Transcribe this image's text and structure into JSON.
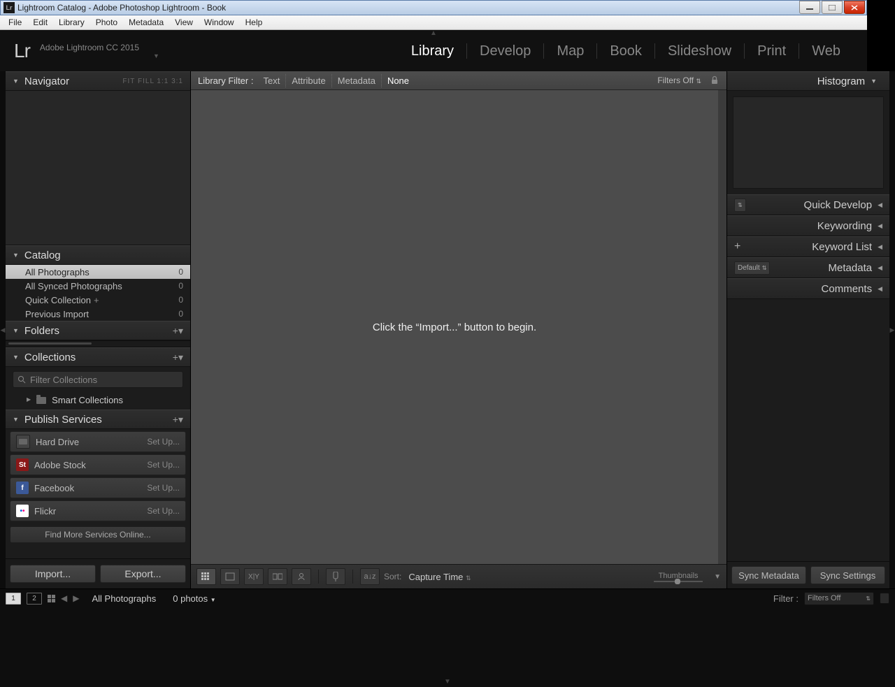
{
  "window": {
    "title": "Lightroom Catalog - Adobe Photoshop Lightroom - Book",
    "app_badge": "Lr"
  },
  "menu": [
    "File",
    "Edit",
    "Library",
    "Photo",
    "Metadata",
    "View",
    "Window",
    "Help"
  ],
  "identity": {
    "logo": "Lr",
    "subtitle": "Adobe Lightroom CC 2015"
  },
  "modules": {
    "items": [
      "Library",
      "Develop",
      "Map",
      "Book",
      "Slideshow",
      "Print",
      "Web"
    ],
    "active": "Library"
  },
  "left": {
    "navigator": {
      "title": "Navigator",
      "opts": "FIT   FILL   1:1   3:1"
    },
    "catalog": {
      "title": "Catalog",
      "rows": [
        {
          "label": "All Photographs",
          "count": "0",
          "selected": true
        },
        {
          "label": "All Synced Photographs",
          "count": "0"
        },
        {
          "label": "Quick Collection",
          "count": "0",
          "plus": true
        },
        {
          "label": "Previous Import",
          "count": "0"
        }
      ]
    },
    "folders": {
      "title": "Folders"
    },
    "collections": {
      "title": "Collections",
      "filter_placeholder": "Filter Collections",
      "smart": "Smart Collections"
    },
    "publish": {
      "title": "Publish Services",
      "rows": [
        {
          "label": "Hard Drive",
          "setup": "Set Up...",
          "icon": "hdd"
        },
        {
          "label": "Adobe Stock",
          "setup": "Set Up...",
          "icon": "st"
        },
        {
          "label": "Facebook",
          "setup": "Set Up...",
          "icon": "fb"
        },
        {
          "label": "Flickr",
          "setup": "Set Up...",
          "icon": "fl"
        }
      ],
      "findmore": "Find More Services Online..."
    },
    "import": "Import...",
    "export": "Export..."
  },
  "center": {
    "filterbar": {
      "label": "Library Filter :",
      "items": [
        "Text",
        "Attribute",
        "Metadata",
        "None"
      ],
      "active": "None",
      "preset": "Filters Off"
    },
    "placeholder": "Click the “Import...” button to begin.",
    "toolbar": {
      "sort_label": "Sort:",
      "sort_value": "Capture Time",
      "thumb_label": "Thumbnails"
    }
  },
  "right": {
    "histogram": "Histogram",
    "panels": [
      {
        "label": "Quick Develop",
        "leading": "dropdown"
      },
      {
        "label": "Keywording"
      },
      {
        "label": "Keyword List",
        "leading": "plus"
      },
      {
        "label": "Metadata",
        "leading": "dropdown",
        "dd": "Default"
      },
      {
        "label": "Comments"
      }
    ],
    "sync_meta": "Sync Metadata",
    "sync_settings": "Sync Settings"
  },
  "filmstrip": {
    "mon1": "1",
    "mon2": "2",
    "path": "All Photographs",
    "count": "0 photos",
    "filter_label": "Filter :",
    "filter_value": "Filters Off"
  }
}
